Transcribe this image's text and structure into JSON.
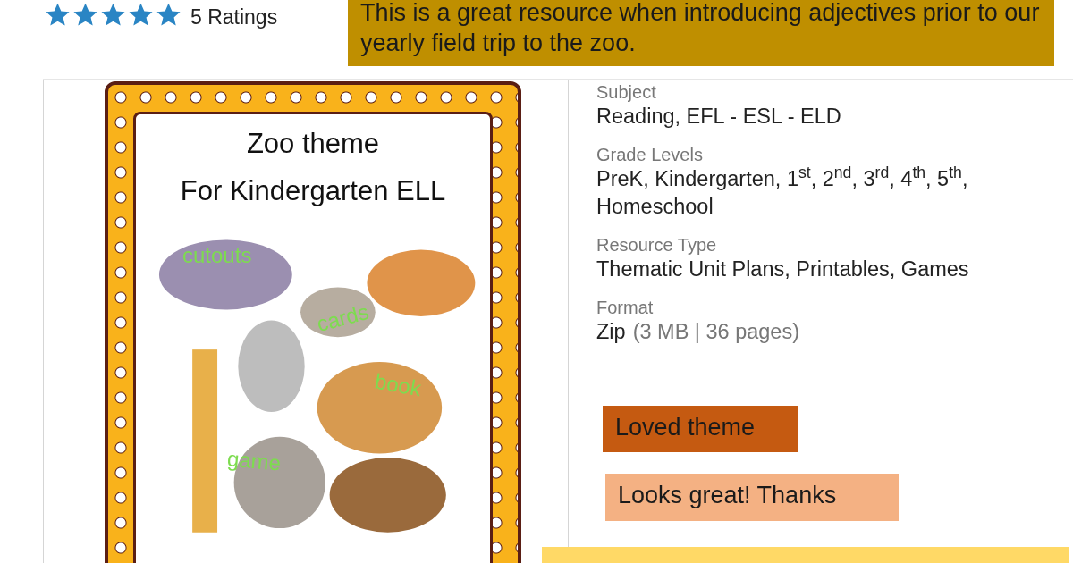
{
  "rating": {
    "stars": 5,
    "label": "5 Ratings"
  },
  "cover": {
    "title": "Zoo theme",
    "subtitle": "For Kindergarten ELL",
    "words": [
      {
        "text": "cutouts",
        "kind": "tag"
      },
      {
        "text": "cards",
        "kind": "tag"
      },
      {
        "text": "book",
        "kind": "tag"
      },
      {
        "text": "game",
        "kind": "tag"
      }
    ]
  },
  "details": [
    {
      "label": "Subject",
      "value": "Reading, EFL - ESL - ELD"
    },
    {
      "label": "Grade Levels",
      "value": "PreK, Kindergarten, 1$^{st}$, 2$^{nd}$, 3$^{rd}$, 4$^{th}$, 5$^{th}$, Homeschool"
    },
    {
      "label": "Resource Type",
      "value": "Thematic Unit Plans, Printables, Games"
    },
    {
      "label": "Format",
      "value": "Zip",
      "note": "(3 MB | 36 pages)"
    }
  ],
  "comments": [
    {
      "text": "This is a great resource when introducing adjectives prior to our yearly field trip to the zoo.",
      "color": "#bf8f00"
    },
    {
      "text": "Loved theme",
      "color": "#c55a11"
    },
    {
      "text": "Looks great! Thanks",
      "color": "#f4b183"
    },
    {
      "color": "#ffd966"
    }
  ]
}
